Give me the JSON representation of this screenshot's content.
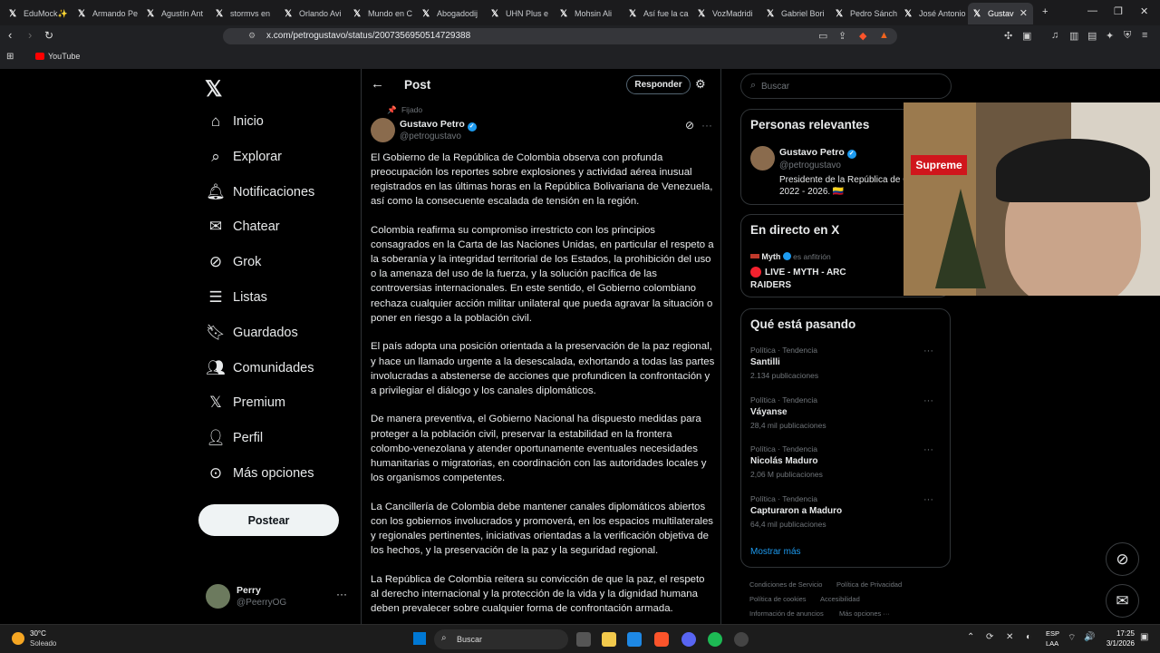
{
  "browser": {
    "tabs": [
      {
        "label": "EduMock✨"
      },
      {
        "label": "Armando Pe"
      },
      {
        "label": "Agustín Ant"
      },
      {
        "label": "stormvs en"
      },
      {
        "label": "Orlando Avi"
      },
      {
        "label": "Mundo en C"
      },
      {
        "label": "Abogadodij"
      },
      {
        "label": "UHN Plus e"
      },
      {
        "label": "Mohsin Ali"
      },
      {
        "label": "Así fue la ca"
      },
      {
        "label": "VozMadridi"
      },
      {
        "label": "Gabriel Bori"
      },
      {
        "label": "Pedro Sánch"
      },
      {
        "label": "José Antonio"
      },
      {
        "label": "Gustav"
      }
    ],
    "url": "x.com/petrogustavo/status/2007356950514729388",
    "bookmark": "YouTube"
  },
  "sidebar": {
    "items": [
      {
        "label": "Inicio",
        "icon": "home-icon"
      },
      {
        "label": "Explorar",
        "icon": "search-icon"
      },
      {
        "label": "Notificaciones",
        "icon": "bell-icon"
      },
      {
        "label": "Chatear",
        "icon": "mail-icon"
      },
      {
        "label": "Grok",
        "icon": "grok-icon"
      },
      {
        "label": "Listas",
        "icon": "list-icon"
      },
      {
        "label": "Guardados",
        "icon": "bookmark-icon"
      },
      {
        "label": "Comunidades",
        "icon": "communities-icon"
      },
      {
        "label": "Premium",
        "icon": "x-logo-icon"
      },
      {
        "label": "Perfil",
        "icon": "person-icon"
      },
      {
        "label": "Más opciones",
        "icon": "more-circle-icon"
      }
    ],
    "post_button": "Postear",
    "user": {
      "name": "Perry",
      "handle": "@PeerryOG"
    }
  },
  "main": {
    "title": "Post",
    "reply_button": "Responder",
    "pinned_label": "Fijado",
    "author": {
      "name": "Gustavo Petro",
      "handle": "@petrogustavo"
    },
    "paragraphs": [
      "El Gobierno de la República de Colombia observa con profunda preocupación los reportes sobre explosiones y actividad aérea inusual registrados en las últimas horas en la República Bolivariana de Venezuela, así como la consecuente escalada de tensión en la región.",
      "Colombia reafirma su compromiso irrestricto con los principios consagrados en la Carta de las Naciones Unidas, en particular el respeto a la soberanía y la integridad territorial de los Estados, la prohibición del uso o la amenaza del uso de la fuerza, y la solución pacífica de las controversias internacionales. En este sentido, el Gobierno colombiano rechaza cualquier acción militar unilateral que pueda agravar la situación o poner en riesgo a la población civil.",
      "El país adopta una posición  orientada a la preservación de la paz regional, y hace un llamado urgente a la desescalada, exhortando a todas las partes involucradas a abstenerse de acciones que profundicen la confrontación y a privilegiar el diálogo y los canales diplomáticos.",
      "De manera preventiva, el Gobierno Nacional ha dispuesto medidas para proteger a la población civil, preservar la estabilidad en la frontera colombo-venezolana y atender oportunamente eventuales necesidades humanitarias o migratorias, en coordinación con las autoridades locales y los organismos competentes.",
      "La Cancillería de Colombia debe mantener canales diplomáticos abiertos con los gobiernos involucrados y promoverá, en los espacios multilaterales y regionales pertinentes, iniciativas orientadas a la verificación objetiva de los hechos, y la preservación de la paz y la seguridad regional.",
      "La República de Colombia reitera su convicción de que la paz, el respeto al derecho internacional y la protección de la vida y la dignidad humana deben prevalecer sobre cualquier forma de confrontación armada."
    ]
  },
  "right": {
    "search_placeholder": "Buscar",
    "relevant": {
      "title": "Personas relevantes",
      "name": "Gustavo Petro",
      "handle": "@petrogustavo",
      "bio": "Presidente de la República de Colombia 2022 - 2026. 🇨🇴"
    },
    "live": {
      "title": "En directo en X",
      "host": "Myth",
      "host_suffix": "es anfitrión",
      "stream": "LIVE - MYTH - ARC RAIDERS"
    },
    "trends": {
      "title": "Qué está pasando",
      "items": [
        {
          "category": "Política · Tendencia",
          "name": "Santilli",
          "count": "2.134 publicaciones"
        },
        {
          "category": "Política · Tendencia",
          "name": "Váyanse",
          "count": "28,4 mil publicaciones"
        },
        {
          "category": "Política · Tendencia",
          "name": "Nicolás Maduro",
          "count": "2,06 M publicaciones"
        },
        {
          "category": "Política · Tendencia",
          "name": "Capturaron a Maduro",
          "count": "64,4 mil publicaciones"
        }
      ],
      "show_more": "Mostrar más"
    },
    "footer": {
      "links": [
        "Condiciones de Servicio",
        "Política de Privacidad",
        "Política de cookies",
        "Accesibilidad",
        "Información de anuncios",
        "Más opciones ···"
      ]
    },
    "webcam_sign": "Supreme"
  },
  "taskbar": {
    "weather_temp": "30°C",
    "weather_desc": "Soleado",
    "search_label": "Buscar",
    "lang": "ESP",
    "lang2": "LAA",
    "time": "17:25",
    "date": "3/1/2026"
  },
  "colors": {
    "background": "#000000",
    "verified": "#1d9bf0",
    "accent_link": "#1d9bf0"
  }
}
